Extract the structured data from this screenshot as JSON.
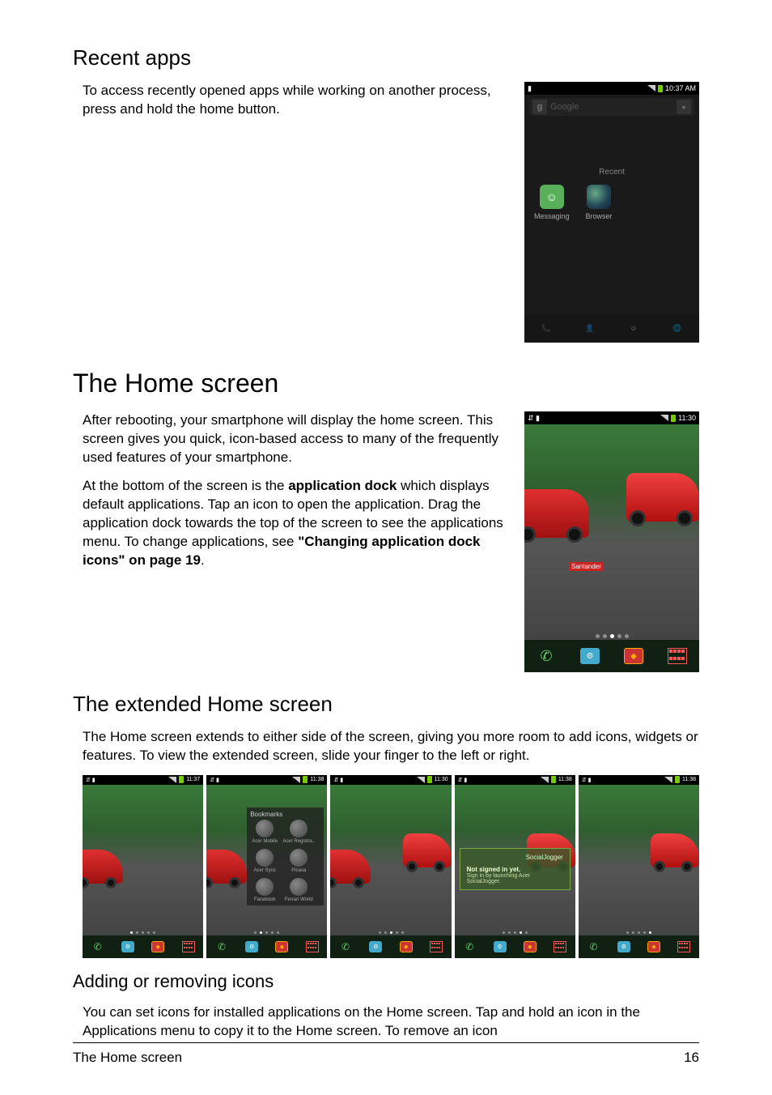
{
  "sections": {
    "recent_heading": "Recent apps",
    "recent_body": "To access recently opened apps while working on another process, press and hold the home button.",
    "home_heading": "The Home screen",
    "home_p1": "After rebooting, your smartphone will display the home screen. This screen gives you quick, icon-based access to many of the frequently used features of your smartphone.",
    "home_p2a": "At the bottom of the screen is the ",
    "home_p2b": "application dock",
    "home_p2c": " which displays default applications. Tap an icon to open the application. Drag the application dock towards the top of the screen to see the applications menu. To change applications, see ",
    "home_p2d": "\"Changing application dock icons\" on page 19",
    "home_p2e": ".",
    "ext_heading": "The extended Home screen",
    "ext_body": "The Home screen extends to either side of the screen, giving you more room to add icons, widgets or features. To view the extended screen, slide your finger to the left or right.",
    "add_heading": "Adding or removing icons",
    "add_body": "You can set icons for installed applications on the Home screen. Tap and hold an icon in the Applications menu to copy it to the Home screen. To remove an icon"
  },
  "recent_shot": {
    "time": "10:37 AM",
    "google_label": "Google",
    "recent_label": "Recent",
    "items": [
      {
        "label": "Messaging"
      },
      {
        "label": "Browser"
      }
    ]
  },
  "home_shot": {
    "time": "11:30",
    "sponsor": "Santander"
  },
  "thumbs": {
    "times": [
      "11:37",
      "11:38",
      "11:30",
      "11:38",
      "11:38"
    ],
    "bookmarks": {
      "heading": "Bookmarks",
      "items": [
        "Acer Mobile",
        "Acer Registra..",
        "Acer Sync",
        "Picasa",
        "Facebook",
        "Ferrari World"
      ]
    },
    "socialjogger": {
      "brand": "SocialJogger",
      "line1": "Not signed in yet.",
      "line2": "Sign in by launching Acer SocialJogger."
    }
  },
  "footer": {
    "left": "The Home screen",
    "right": "16"
  }
}
